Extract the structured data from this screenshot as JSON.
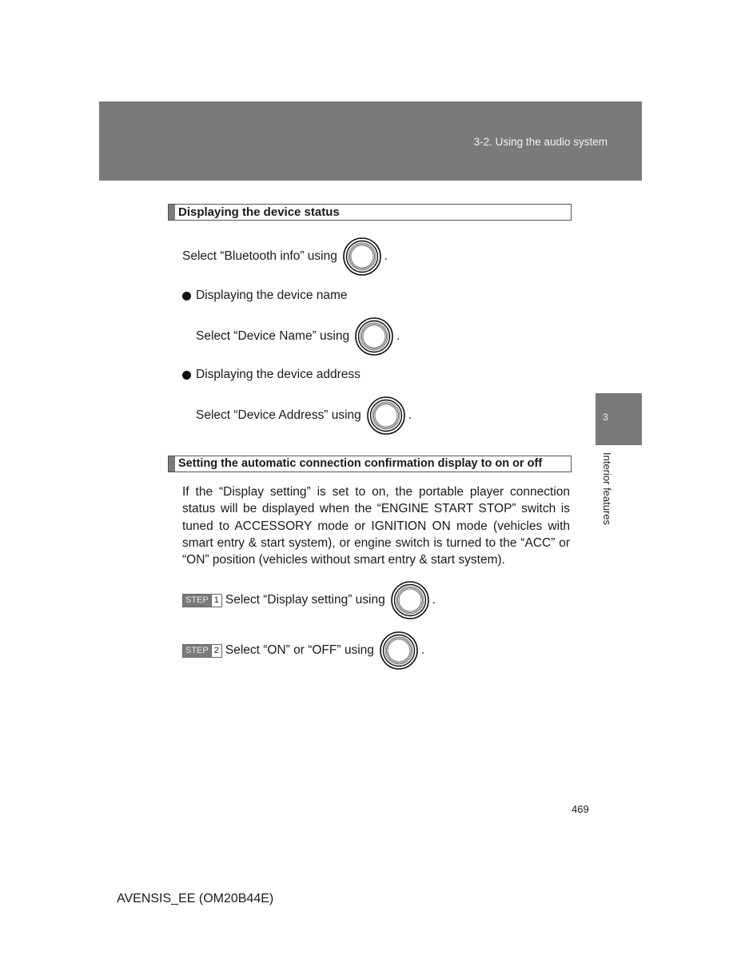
{
  "header": {
    "section_title": "3-2. Using the audio system"
  },
  "side_tab": {
    "chapter_number": "3",
    "chapter_label": "Interior features"
  },
  "section1": {
    "heading": "Displaying the device status",
    "intro": {
      "text": "Select “Bluetooth info” using",
      "icon": "tune-select-knob-icon",
      "end": "."
    },
    "bullets": [
      {
        "label": "Displaying the device name",
        "instruction": "Select “Device Name” using",
        "end": "."
      },
      {
        "label": "Displaying the device address",
        "instruction": "Select “Device Address” using",
        "end": "."
      }
    ]
  },
  "section2": {
    "heading": "Setting the automatic connection confirmation display to on or off",
    "paragraph": "If the “Display setting” is set to on, the portable player connection status will be displayed when the “ENGINE START STOP” switch is tuned to ACCESSORY mode or IGNITION ON mode (vehicles with smart entry & start system), or engine switch is turned to the “ACC” or “ON” position (vehicles without smart entry & start system).",
    "steps": [
      {
        "badge": "STEP",
        "number": "1",
        "text": "Select “Display setting” using",
        "end": "."
      },
      {
        "badge": "STEP",
        "number": "2",
        "text": "Select “ON” or “OFF” using",
        "end": "."
      }
    ]
  },
  "page_number": "469",
  "footer": "AVENSIS_EE (OM20B44E)"
}
